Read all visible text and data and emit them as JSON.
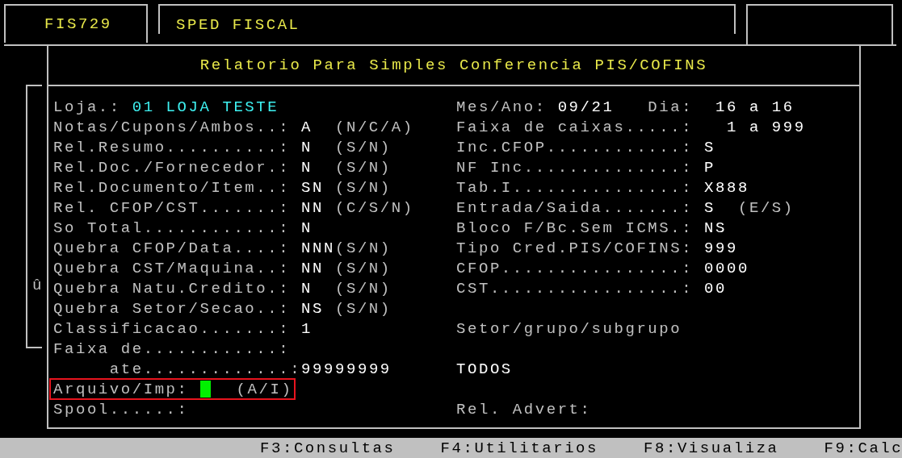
{
  "header": {
    "program": "FIS729",
    "module": "SPED FISCAL"
  },
  "dialog": {
    "title": "Relatorio Para Simples Conferencia PIS/COFINS",
    "scroll_mark": "û",
    "left_fields": [
      {
        "kind": "store",
        "label": "Loja.:",
        "value": "01 LOJA TESTE"
      },
      {
        "kind": "field",
        "label": "Notas/Cupons/Ambos..:",
        "value": "A",
        "hint": "(N/C/A)"
      },
      {
        "kind": "field",
        "label": "Rel.Resumo..........:",
        "value": "N",
        "hint": "(S/N)"
      },
      {
        "kind": "field",
        "label": "Rel.Doc./Fornecedor.:",
        "value": "N",
        "hint": "(S/N)"
      },
      {
        "kind": "field",
        "label": "Rel.Documento/Item..:",
        "value": "SN",
        "hint": "(S/N)"
      },
      {
        "kind": "field",
        "label": "Rel. CFOP/CST.......:",
        "value": "NN",
        "hint": "(C/S/N)"
      },
      {
        "kind": "field",
        "label": "So Total............:",
        "value": "N"
      },
      {
        "kind": "field",
        "label": "Quebra CFOP/Data....:",
        "value": "NNN",
        "hint": "(S/N)"
      },
      {
        "kind": "field",
        "label": "Quebra CST/Maquina..:",
        "value": "NN",
        "hint": "(S/N)"
      },
      {
        "kind": "field",
        "label": "Quebra Natu.Credito.:",
        "value": "N",
        "hint": "(S/N)"
      },
      {
        "kind": "field",
        "label": "Quebra Setor/Secao..:",
        "value": "NS",
        "hint": "(S/N)"
      },
      {
        "kind": "field",
        "label": "Classificacao.......:",
        "value": "1"
      },
      {
        "kind": "field",
        "label": "Faixa de............:"
      },
      {
        "kind": "sub",
        "label": "ate.............:",
        "value": "99999999"
      },
      {
        "kind": "cursor",
        "label": "Arquivo/Imp:",
        "hint": "(A/I)",
        "focused": true
      },
      {
        "kind": "field",
        "label": "Spool......:"
      }
    ],
    "right_fields": [
      {
        "kind": "date",
        "label": "Mes/Ano:",
        "value": "09/21",
        "label_2": "Dia:",
        "value_2": "16 a 16"
      },
      {
        "kind": "range",
        "label": "Faixa de caixas.....:",
        "value": "1 a 999"
      },
      {
        "kind": "field",
        "label": "Inc.CFOP............:",
        "value": "S"
      },
      {
        "kind": "field",
        "label": "NF Inc..............:",
        "value": "P"
      },
      {
        "kind": "field",
        "label": "Tab.I...............:",
        "value": "X888"
      },
      {
        "kind": "field",
        "label": "Entrada/Saida.......:",
        "value": "S",
        "hint": "(E/S)"
      },
      {
        "kind": "field",
        "label": "Bloco F/Bc.Sem ICMS.:",
        "value": "NS"
      },
      {
        "kind": "field",
        "label": "Tipo Cred.PIS/COFINS:",
        "value": "999"
      },
      {
        "kind": "field",
        "label": "CFOP................:",
        "value": "0000"
      },
      {
        "kind": "field",
        "label": "CST.................:",
        "value": "00"
      },
      {
        "kind": "section",
        "label": "Setor/grupo/subgrupo"
      },
      {
        "kind": "section_value",
        "value": "TODOS"
      },
      {
        "kind": "section",
        "label": "Rel. Advert:"
      }
    ]
  },
  "function_keys": [
    "F3:Consultas",
    "F4:Utilitarios",
    "F8:Visualiza",
    "F9:Calc"
  ]
}
